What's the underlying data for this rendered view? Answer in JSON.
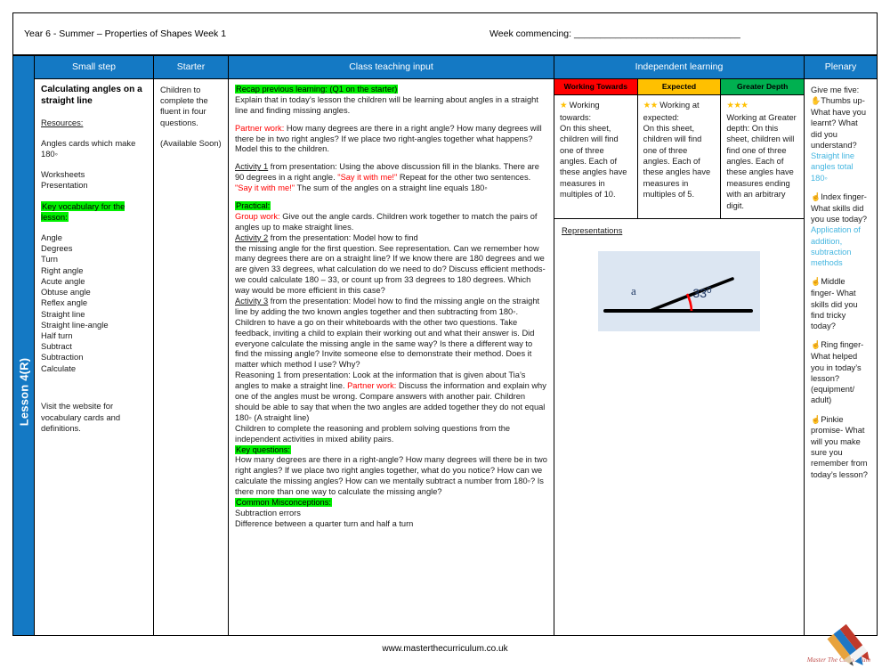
{
  "header": {
    "year_title": "Year 6 -  Summer – Properties of Shapes Week 1",
    "week_commencing": "Week commencing: ________________________________"
  },
  "spine": {
    "lesson_label": "Lesson 4(R)"
  },
  "columns": {
    "small_step": "Small step",
    "starter": "Starter",
    "teaching": "Class teaching input",
    "independent": "Independent learning",
    "plenary": "Plenary"
  },
  "small_step": {
    "title": "Calculating angles on a straight line",
    "resources_label": "Resources:",
    "resource_1": "Angles cards which make 180◦",
    "resource_2": "Worksheets",
    "resource_3": "Presentation",
    "vocab_heading": "Key vocabulary for the lesson:",
    "vocab": [
      "Angle",
      "Degrees",
      "Turn",
      "Right angle",
      "Acute angle",
      "Obtuse angle",
      "Reflex angle",
      "Straight line",
      "Straight line-angle",
      "Half turn",
      "Subtract",
      "Subtraction",
      "Calculate"
    ],
    "visit_note": "Visit the website for vocabulary cards and definitions."
  },
  "starter": {
    "line_1": "Children to complete the fluent in four questions.",
    "line_2": "(Available Soon)"
  },
  "teaching": {
    "recap_heading": "Recap previous learning: (Q1 on the starter)",
    "recap_body": "Explain that in today’s lesson the children will be learning about angles in a straight line and finding missing angles.",
    "partner_label_1": "Partner work:",
    "partner_body_1": " How many degrees are there in a right angle? How many degrees will there be in two right angles? If we place two right-angles together what happens? Model this to the children.",
    "activity1_label": "Activity 1",
    "activity1_body": " from presentation: Using the above discussion fill in the blanks. There are 90 degrees in a right angle. ",
    "activity1_quote": "\"Say it with me!\"",
    "activity1_body2": " Repeat for the other two sentences.",
    "say_it_quote": "\"Say it with me!\"",
    "say_it_body": " The sum of the angles on a straight line equals 180◦",
    "practical_heading": "Practical:",
    "group_label": "Group work:",
    "group_body": " Give out the angle cards. Children work together to match the pairs of angles up to make straight lines.",
    "activity2_label": "Activity 2",
    "activity2_body": " from the presentation: Model how to find",
    "activity2_body2": "the missing angle for the first question. See representation. Can we remember how many degrees there are on a straight line? If we know there are 180 degrees and we are given 33 degrees, what calculation do we need to do? Discuss efficient methods- we could calculate 180 – 33, or count up from 33 degrees to 180 degrees. Which way would be more efficient in this case?",
    "activity3_label": "Activity 3",
    "activity3_body": " from the presentation: Model how to find the missing angle on the straight line by adding the two known angles together and then subtracting from 180◦. Children to have a go on their whiteboards with the other two questions. Take feedback, inviting a child to explain their working out and what their answer is. Did everyone calculate the missing angle in the same way? Is there a different way to find the missing angle? Invite someone else to demonstrate their method. Does it matter which method I use? Why?",
    "reasoning_body": "Reasoning 1 from presentation: Look at the information that is given about Tia’s angles to make a straight line. ",
    "partner_label_2": "Partner work:",
    "partner_body_2": " Discuss the information and explain why one of the angles must be wrong. Compare answers with another pair. Children should be able to say that when the two angles are added together they do not equal 180◦ (A straight line)",
    "complete_body": "Children to complete the reasoning and problem solving questions from the independent activities in mixed ability pairs.",
    "key_questions_heading": "Key questions:",
    "key_questions_body": "How many degrees are there in a right-angle? How many degrees will there be in two right angles? If we place two right angles together, what do you notice? How can we calculate the missing angles? How can we mentally subtract a number from 180◦? Is there more than one way to calculate the missing angle?",
    "misconceptions_heading": "Common Misconceptions:",
    "misconception_1": "Subtraction errors",
    "misconception_2": "Difference between a quarter turn and half a turn"
  },
  "independent": {
    "tiers": [
      {
        "label": "Working Towards",
        "color": "#ff0000",
        "stars": "★",
        "intro": " Working towards:",
        "body": "On this sheet, children will find one of three angles. Each of these angles have measures in multiples of 10."
      },
      {
        "label": "Expected",
        "color": "#ffc000",
        "stars": "★★",
        "intro": " Working at expected:",
        "body": " On this sheet, children will find one of three angles. Each of these angles have measures in multiples of 5."
      },
      {
        "label": "Greater Depth",
        "color": "#00b050",
        "stars": "★★★",
        "intro": "",
        "body": "Working at Greater depth: On this sheet, children will find one of three angles. Each of these angles have measures ending with an arbitrary digit."
      }
    ],
    "representations_label": "Representations",
    "diagram": {
      "unknown_angle_label": "a",
      "known_angle_label": "33",
      "known_angle_degree": "0",
      "arc_color": "#ff0000",
      "background": "#dce6f2"
    }
  },
  "plenary": {
    "intro": "Give me five:",
    "items": [
      {
        "hand": "✋",
        "prompt": "Thumbs up- What have you learnt? What did you understand?",
        "answer": "Straight line angles total 180◦"
      },
      {
        "hand": "☝",
        "prompt": "Index finger- What skills did you use today?",
        "answer": "Application of addition, subtraction methods"
      },
      {
        "hand": "☝",
        "prompt": "Middle finger- What skills did you find tricky today?",
        "answer": ""
      },
      {
        "hand": "☝",
        "prompt": "Ring finger- What helped you in today’s lesson? (equipment/ adult)",
        "answer": ""
      },
      {
        "hand": "☝",
        "prompt": "Pinkie promise- What will you make sure you remember from today’s lesson?",
        "answer": ""
      }
    ]
  },
  "footer": {
    "website": "www.masterthecurriculum.co.uk",
    "logo_text": "Master The Curriculum"
  }
}
